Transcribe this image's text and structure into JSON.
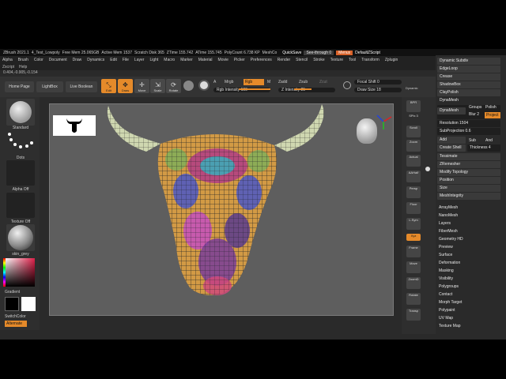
{
  "title_bar": {
    "app": "ZBrush 2021.1",
    "doc": "4_Test_Lowpoly",
    "free_mem": "Free Mem 25.065GB",
    "active_mem": "Active Mem 1537",
    "scratch_disk": "Scratch Disk 365",
    "ztime": "ZTime 155.742",
    "atime": "ATime 155.745",
    "polycount": "PolyCount 6.738 KP",
    "meshcount": "MeshCo",
    "quicksave": "QuickSave",
    "see_through": "See-through  0",
    "menus": "Menus",
    "default_zscript": "DefaultZScript"
  },
  "menu": [
    "Alpha",
    "Brush",
    "Color",
    "Document",
    "Draw",
    "Dynamics",
    "Edit",
    "File",
    "Layer",
    "Light",
    "Macro",
    "Marker",
    "Material",
    "Movie",
    "Picker",
    "Preferences",
    "Render",
    "Stencil",
    "Stroke",
    "Texture",
    "Tool",
    "Transform",
    "Zplugin"
  ],
  "menu2": [
    "Zscript",
    "Help"
  ],
  "coords": "0.404,-0.905,-0.154",
  "shelf": {
    "home_page": "Home Page",
    "lightbox": "LightBox",
    "live_boolean": "Live Boolean",
    "edit": "Edit",
    "draw": "Draw",
    "move": "Move",
    "scale": "Scale",
    "rotate": "Rotate",
    "a": "A",
    "mrgb": "Mrgb",
    "rgb": "Rgb",
    "m": "M",
    "zadd": "Zadd",
    "zsub": "Zsub",
    "zcut": "Zcut",
    "rgb_intensity": "Rgb Intensity 100",
    "z_intensity": "Z Intensity 25",
    "focal_shift": "Focal Shift 0",
    "draw_size": "Draw Size 18",
    "dynamic": "Dynamic"
  },
  "left_tray": {
    "brush": "Standard",
    "stroke": "Dots",
    "alpha": "Alpha Off",
    "texture": "Texture Off",
    "material": "skin_grey",
    "gradient": "Gradient",
    "switch_color": "SwitchColor",
    "alternate": "Alternate"
  },
  "right_tray": [
    "BPR",
    "SPix 3",
    "Scroll",
    "Zoom",
    "Actual",
    "AAHalf",
    "Persp",
    "Floor",
    "L.Sym",
    "Xyz",
    "Frame",
    "Move",
    "ZoomD",
    "Rotate",
    "Transp"
  ],
  "palette": {
    "top": [
      "Dynamic Subdiv",
      "EdgeLoop",
      "Crease",
      "ShadowBox",
      "ClayPolish"
    ],
    "dynamesh_header": "DynaMesh",
    "dynamesh_btn": "DynaMesh",
    "groups": "Groups",
    "polish": "Polish",
    "blur": "Blur 2",
    "project": "Project",
    "resolution": "Resolution 1504",
    "subprojection": "SubProjection 0.6",
    "add": "Add",
    "sub": "Sub",
    "and": "And",
    "create_shell": "Create Shell",
    "thickness": "Thickness 4",
    "mid": [
      "Tessimate",
      "ZRemesher",
      "Modify Topology",
      "Position",
      "Size",
      "MeshIntegrity"
    ],
    "subpalettes": [
      "ArrayMesh",
      "NanoMesh",
      "Layers",
      "FiberMesh",
      "Geometry HD",
      "Preview",
      "Surface",
      "Deformation",
      "Masking",
      "Visibility",
      "Polygroups",
      "Contact",
      "Morph Target",
      "Polypaint",
      "UV Map",
      "Texture Map"
    ]
  },
  "colors": {
    "accent": "#e58a2a",
    "bg": "#2a2a2a",
    "canvas": "#5e5e5e"
  }
}
